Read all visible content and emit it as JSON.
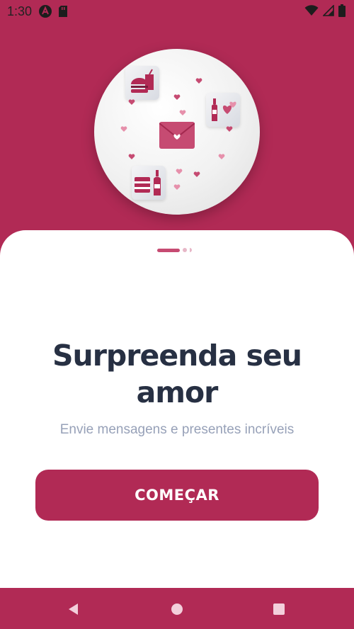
{
  "status_bar": {
    "time": "1:30",
    "left_icons": [
      "android-debug-icon",
      "sd-card-icon"
    ],
    "right_icons": [
      "wifi-icon",
      "signal-icon",
      "battery-icon"
    ]
  },
  "hero": {
    "illustration_icons": [
      "burger-drink-icon",
      "wine-balloons-icon",
      "love-letter-icon",
      "cake-wine-icon",
      "heart-icon"
    ]
  },
  "pager": {
    "total": 3,
    "active_index": 0
  },
  "onboarding": {
    "headline": "Surpreenda seu amor",
    "subtitle": "Envie mensagens e presentes incríveis",
    "cta_label": "COMEÇAR"
  },
  "nav_bar": {
    "icons": [
      "back-icon",
      "home-icon",
      "recents-icon"
    ]
  },
  "colors": {
    "primary": "#b12a55",
    "headline": "#273043",
    "subtitle": "#97a1b8",
    "card": "#ffffff"
  }
}
